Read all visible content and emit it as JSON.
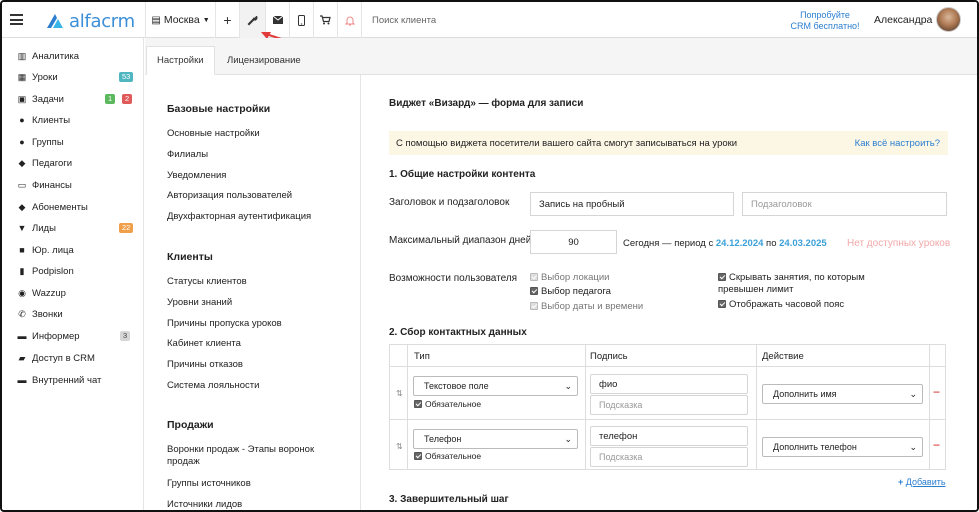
{
  "topbar": {
    "logo_text": "alfacrm",
    "city": "Москва",
    "search_placeholder": "Поиск клиента",
    "promo_line1": "Попробуйте",
    "promo_line2": "CRM бесплатно!",
    "username": "Александра"
  },
  "sidebar": {
    "items": [
      {
        "label": "Аналитика",
        "icon": "chart-icon"
      },
      {
        "label": "Уроки",
        "icon": "calendar-icon",
        "badge": "53"
      },
      {
        "label": "Задачи",
        "icon": "clipboard-icon",
        "badge": "1",
        "badge2": "2"
      },
      {
        "label": "Клиенты",
        "icon": "user-icon"
      },
      {
        "label": "Группы",
        "icon": "users-icon"
      },
      {
        "label": "Педагоги",
        "icon": "graduation-cap-icon"
      },
      {
        "label": "Финансы",
        "icon": "money-icon"
      },
      {
        "label": "Абонементы",
        "icon": "tag-icon"
      },
      {
        "label": "Лиды",
        "icon": "funnel-icon",
        "badge": "22"
      },
      {
        "label": "Юр. лица",
        "icon": "briefcase-icon"
      },
      {
        "label": "Podpislon",
        "icon": "document-icon"
      },
      {
        "label": "Wazzup",
        "icon": "whatsapp-icon"
      },
      {
        "label": "Звонки",
        "icon": "phone-icon"
      },
      {
        "label": "Информер",
        "icon": "inbox-icon",
        "badge": "3"
      },
      {
        "label": "Доступ в CRM",
        "icon": "lock-icon"
      },
      {
        "label": "Внутренний чат",
        "icon": "chat-icon"
      }
    ],
    "colors": {
      "teal": "#4fb6bf",
      "green": "#5cb85c",
      "red": "#e05a5a",
      "orange": "#f0a04b",
      "gray": "#c8c8c8"
    }
  },
  "tabs": [
    "Настройки",
    "Лицензирование"
  ],
  "settings_menu": {
    "basic_title": "Базовые настройки",
    "basic": [
      "Основные настройки",
      "Филиалы",
      "Уведомления",
      "Авторизация пользователей",
      "Двухфакторная аутентификация"
    ],
    "clients_title": "Клиенты",
    "clients": [
      "Статусы клиентов",
      "Уровни знаний",
      "Причины пропуска уроков",
      "Кабинет клиента",
      "Причины отказов",
      "Система лояльности"
    ],
    "sales_title": "Продажи",
    "sales": [
      "Воронки продаж - Этапы воронок продаж",
      "Группы источников",
      "Источники лидов"
    ]
  },
  "main": {
    "title": "Виджет «Визард» — форма для записи",
    "notice": "С помощью виджета посетители вашего сайта смогут записываться на уроки",
    "notice_link": "Как всё настроить?",
    "s1_title": "1. Общие настройки контента",
    "heading_label": "Заголовок и подзаголовок",
    "heading_value": "Запись на пробный",
    "subheading_placeholder": "Подзаголовок",
    "range_label": "Максимальный диапазон дней",
    "range_value": "90",
    "range_text_before": "Сегодня — период с",
    "range_from": "24.12.2024",
    "range_mid": "по",
    "range_to": "24.03.2025",
    "range_warning": "Нет доступных уроков",
    "caps_label": "Возможности пользователя",
    "caps_left": [
      {
        "label": "Выбор локации",
        "state": "disabled"
      },
      {
        "label": "Выбор педагога",
        "state": "checked"
      },
      {
        "label": "Выбор даты и времени",
        "state": "disabled"
      }
    ],
    "caps_right": [
      {
        "label": "Скрывать занятия, по которым превышен лимит",
        "state": "checked"
      },
      {
        "label": "Отображать часовой пояс",
        "state": "checked"
      }
    ],
    "s2_title": "2. Сбор контактных данных",
    "table": {
      "headers": [
        "Тип",
        "Подпись",
        "Действие"
      ],
      "rows": [
        {
          "type": "Текстовое поле",
          "required": "Обязательное",
          "label": "фио",
          "hint_placeholder": "Подсказка",
          "action": "Дополнить имя"
        },
        {
          "type": "Телефон",
          "required": "Обязательное",
          "label": "телефон",
          "hint_placeholder": "Подсказка",
          "action": "Дополнить телефон"
        }
      ]
    },
    "add_label": "Добавить",
    "s3_title": "3. Завершительный шаг"
  }
}
